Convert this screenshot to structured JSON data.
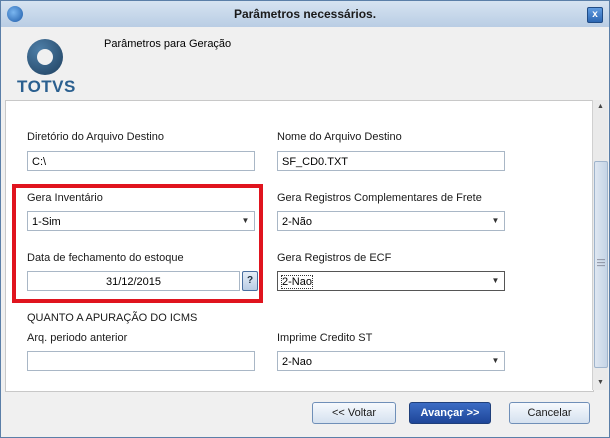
{
  "window": {
    "title": "Parâmetros necessários.",
    "close_glyph": "x"
  },
  "header": {
    "logo_text": "TOTVS",
    "subtitle": "Parâmetros para Geração"
  },
  "fields": {
    "dir_destino": {
      "label": "Diretório do Arquivo Destino",
      "value": "C:\\"
    },
    "nome_destino": {
      "label": "Nome do Arquivo Destino",
      "value": "SF_CD0.TXT"
    },
    "gera_inventario": {
      "label": "Gera Inventário",
      "value": "1-Sim"
    },
    "gera_reg_frete": {
      "label": "Gera Registros Complementares de Frete",
      "value": "2-Não"
    },
    "data_fechamento": {
      "label": "Data de fechamento do estoque",
      "value": "31/12/2015",
      "help": "?"
    },
    "gera_reg_ecf": {
      "label": "Gera Registros de ECF",
      "value": "2-Nao"
    },
    "section_icms": "QUANTO A APURAÇÃO DO ICMS",
    "arq_periodo": {
      "label": "Arq. periodo anterior",
      "value": ""
    },
    "imprime_credito": {
      "label": "Imprime Credito ST",
      "value": "2-Nao"
    }
  },
  "buttons": {
    "voltar": "<< Voltar",
    "avancar": "Avançar >>",
    "cancelar": "Cancelar"
  },
  "icons": {
    "dropdown": "chevron-down-icon",
    "scroll_up": "scroll-up-icon",
    "scroll_down": "scroll-down-icon"
  },
  "colors": {
    "highlight": "#e0141e",
    "primary_button": "#1e4699",
    "logo": "#2a5f8f"
  }
}
